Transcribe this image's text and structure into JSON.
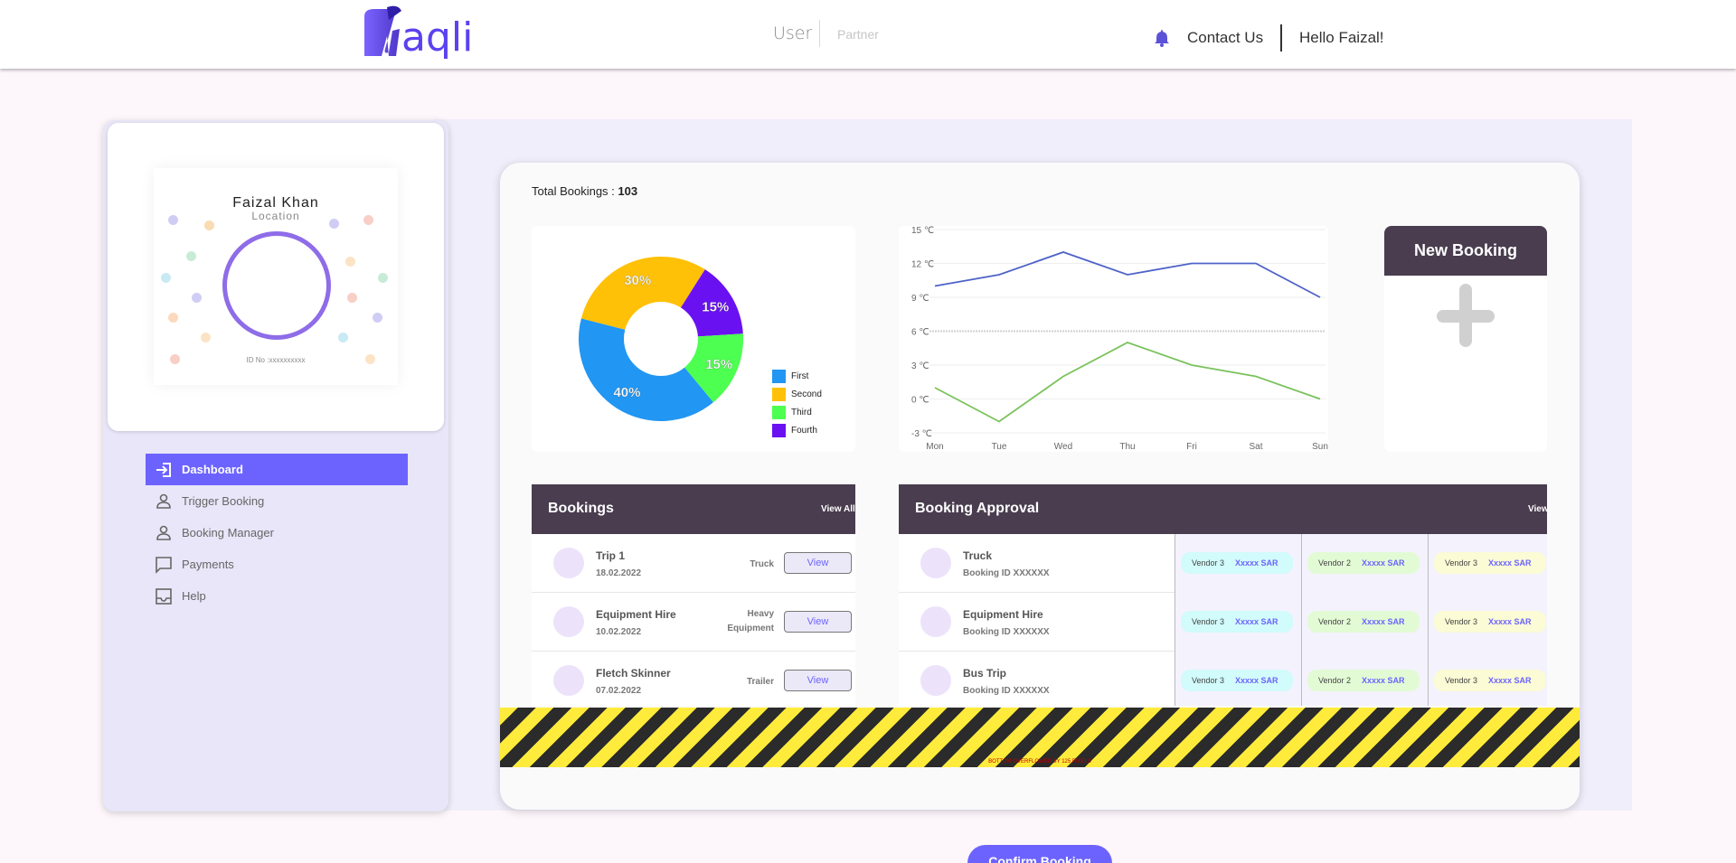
{
  "header": {
    "brand": "naqli",
    "nav": {
      "user": "User",
      "partner": "Partner"
    },
    "contact": "Contact Us",
    "greeting": "Hello Faizal!"
  },
  "profile": {
    "name": "Faizal Khan",
    "location": "Location",
    "id_label": "ID No :xxxxxxxxxx"
  },
  "sidebar": {
    "items": [
      {
        "label": "Dashboard",
        "icon": "login-icon",
        "active": true
      },
      {
        "label": "Trigger Booking",
        "icon": "person-icon",
        "active": false
      },
      {
        "label": "Booking Manager",
        "icon": "person-icon",
        "active": false
      },
      {
        "label": "Payments",
        "icon": "message-icon",
        "active": false
      },
      {
        "label": "Help",
        "icon": "inbox-icon",
        "active": false
      }
    ]
  },
  "dashboard": {
    "total_label": "Total Bookings : ",
    "total_value": "103",
    "new_booking": "New Booking"
  },
  "chart_data": [
    {
      "type": "pie",
      "style": "donut",
      "labels": [
        "First",
        "Second",
        "Third",
        "Fourth"
      ],
      "values": [
        40,
        30,
        15,
        15
      ],
      "slice_labels": [
        "40%",
        "30%",
        "15%",
        "15%"
      ],
      "colors": [
        "#2196f3",
        "#ffc107",
        "#4cff50",
        "#6a11f2"
      ],
      "legend_position": "bottom-right"
    },
    {
      "type": "line",
      "categories": [
        "Mon",
        "Tue",
        "Wed",
        "Thu",
        "Fri",
        "Sat",
        "Sun"
      ],
      "y_ticks": [
        "15 ℃",
        "12 ℃",
        "9 ℃",
        "6 ℃",
        "3 ℃",
        "0 ℃",
        "-3 ℃"
      ],
      "ylim": [
        -3,
        15
      ],
      "series": [
        {
          "values": [
            10,
            11,
            13,
            11,
            12,
            12,
            9
          ],
          "color": "#4e63c8"
        },
        {
          "values": [
            1,
            -2,
            2,
            5,
            3,
            2,
            0
          ],
          "color": "#7ac25c"
        }
      ],
      "grid": true
    }
  ],
  "bookings": {
    "title": "Bookings",
    "view_all": "View All",
    "rows": [
      {
        "name": "Trip 1",
        "date": "18.02.2022",
        "type": "Truck",
        "action": "View"
      },
      {
        "name": "Equipment Hire",
        "date": "10.02.2022",
        "type": "Heavy Equipment",
        "action": "View"
      },
      {
        "name": "Fletch Skinner",
        "date": "07.02.2022",
        "type": "Trailer",
        "action": "View"
      }
    ]
  },
  "approval": {
    "title": "Booking Approval",
    "view": "View",
    "rows": [
      {
        "name": "Truck",
        "booking_id": "Booking ID XXXXXX"
      },
      {
        "name": "Equipment Hire",
        "booking_id": "Booking ID XXXXXX"
      },
      {
        "name": "Bus Trip",
        "booking_id": "Booking ID XXXXXX"
      }
    ],
    "vendors": [
      {
        "label": "Vendor 3",
        "amount": "Xxxxx SAR",
        "color": "#d2fbfb"
      },
      {
        "label": "Vendor 2",
        "amount": "Xxxxx SAR",
        "color": "#e3fbd5"
      },
      {
        "label": "Vendor 3",
        "amount": "Xxxxx SAR",
        "color": "#fbfbd5"
      }
    ]
  },
  "overflow_message": "BOTTOM OVERFLOWED BY 125 PIXELS",
  "confirm_button": "Confirm Booking"
}
